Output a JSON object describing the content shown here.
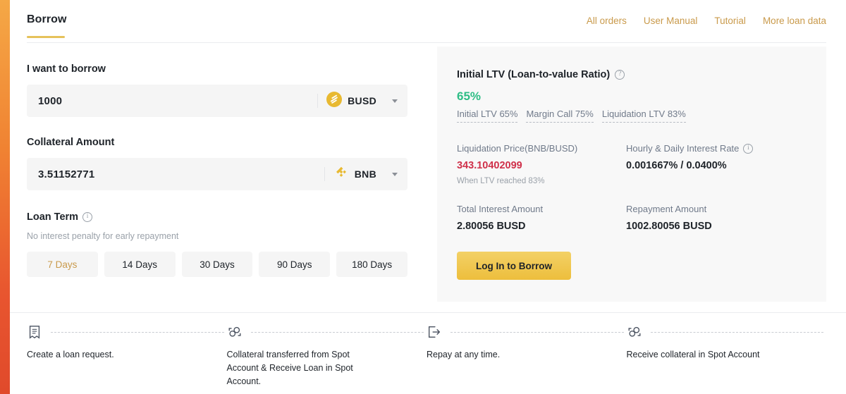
{
  "header": {
    "tab_label": "Borrow",
    "links": [
      {
        "label": "All orders"
      },
      {
        "label": "User Manual"
      },
      {
        "label": "Tutorial"
      },
      {
        "label": "More loan data"
      }
    ],
    "accent_color": "#c99a4b",
    "underline_color": "#e6c25a"
  },
  "form": {
    "borrow": {
      "label": "I want to borrow",
      "value": "1000",
      "asset": "BUSD",
      "asset_icon": "busd-coin-icon"
    },
    "collateral": {
      "label": "Collateral Amount",
      "value": "3.51152771",
      "asset": "BNB",
      "asset_icon": "bnb-coin-icon"
    },
    "loan_term": {
      "label": "Loan Term",
      "info_icon": "info-icon",
      "hint": "No interest penalty for early repayment",
      "options": [
        {
          "label": "7 Days",
          "selected": true
        },
        {
          "label": "14 Days",
          "selected": false
        },
        {
          "label": "30 Days",
          "selected": false
        },
        {
          "label": "90 Days",
          "selected": false
        },
        {
          "label": "180 Days",
          "selected": false
        }
      ]
    }
  },
  "summary": {
    "ltv_title": "Initial LTV (Loan-to-value Ratio)",
    "ltv_help_icon": "question-icon",
    "ltv_value": "65%",
    "ltv_value_color": "#2ebd85",
    "ltv_legend": [
      {
        "label": "Initial LTV 65%"
      },
      {
        "label": "Margin Call 75%"
      },
      {
        "label": "Liquidation LTV 83%"
      }
    ],
    "liquidation_price": {
      "label": "Liquidation Price(BNB/BUSD)",
      "value": "343.10402099",
      "value_color": "#cf304a",
      "sub": "When LTV reached 83%"
    },
    "interest_rate": {
      "label": "Hourly & Daily Interest Rate",
      "info_icon": "info-icon",
      "value": "0.001667% / 0.0400%"
    },
    "total_interest": {
      "label": "Total Interest Amount",
      "value": "2.80056 BUSD"
    },
    "repayment": {
      "label": "Repayment Amount",
      "value": "1002.80056 BUSD"
    },
    "cta_label": "Log In to Borrow",
    "cta_color": "#edbe3c"
  },
  "steps": [
    {
      "icon": "loan-request-document-icon",
      "text": "Create a loan request."
    },
    {
      "icon": "transfer-circles-icon",
      "text": "Collateral transferred from Spot Account & Receive Loan in Spot Account."
    },
    {
      "icon": "repay-export-icon",
      "text": "Repay at any time."
    },
    {
      "icon": "transfer-circles-icon",
      "text": "Receive collateral in Spot Account"
    }
  ]
}
